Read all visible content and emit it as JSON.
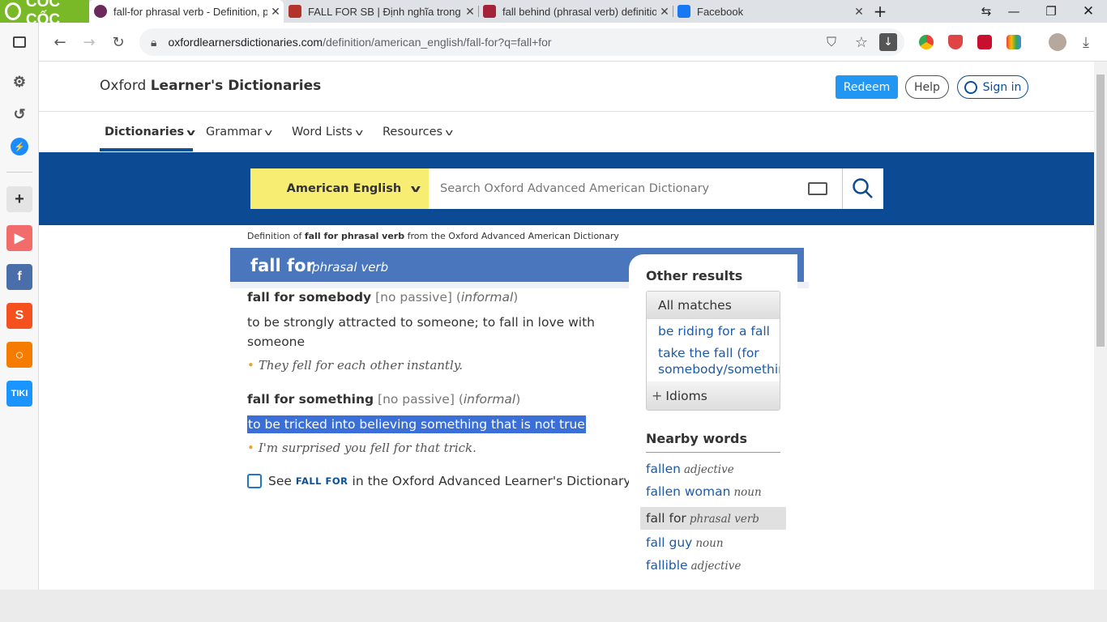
{
  "browser": {
    "brand": "CỐC CỐC",
    "tabs": [
      {
        "title": "fall-for phrasal verb - Definition, p",
        "active": true,
        "favicon_color": "#6b2a5c"
      },
      {
        "title": "FALL FOR SB | Định nghĩa trong Từ",
        "active": false,
        "favicon_color": "#b3342b"
      },
      {
        "title": "fall behind (phrasal verb) definition",
        "active": false,
        "favicon_color": "#a3233a"
      },
      {
        "title": "Facebook",
        "active": false,
        "favicon_color": "#1877f2"
      }
    ],
    "url_host": "oxfordlearnersdictionaries.com",
    "url_path": "/definition/american_english/fall-for?q=fall+for"
  },
  "site": {
    "title_plain": "Oxford",
    "title_bold": "Learner's Dictionaries",
    "redeem": "Redeem",
    "help": "Help",
    "signin": "Sign in",
    "nav": [
      "Dictionaries",
      "Grammar",
      "Word Lists",
      "Resources"
    ],
    "dictionary_selector": "American English",
    "search_placeholder": "Search Oxford Advanced American Dictionary"
  },
  "entry": {
    "def_prefix": "Definition of",
    "def_bold": "fall for phrasal verb",
    "def_suffix": "from the Oxford Advanced American Dictionary",
    "headword": "fall for",
    "pos": "phrasal verb",
    "senses": [
      {
        "phrase": "fall for somebody",
        "grammar": "[no passive]",
        "label": "informal",
        "definition": "to be strongly attracted to someone; to fall in love with someone",
        "example": "They fell for each other instantly."
      },
      {
        "phrase": "fall for something",
        "grammar": "[no passive]",
        "label": "informal",
        "definition": "to be tricked into believing something that is not true",
        "example": "I'm surprised you fell for that trick."
      }
    ],
    "see_prefix": "See",
    "see_link": "FALL FOR",
    "see_suffix": "in the Oxford Advanced Learner's Dictionary"
  },
  "sidebar": {
    "other_results": "Other results",
    "all_matches": "All matches",
    "matches": [
      "be riding for a fall",
      "take the fall (for",
      "somebody/somethin"
    ],
    "idioms": "Idioms",
    "nearby_title": "Nearby words",
    "nearby": [
      {
        "word": "fallen",
        "pos": "adjective"
      },
      {
        "word": "fallen woman",
        "pos": "noun"
      },
      {
        "word": "fall for",
        "pos": "phrasal verb",
        "current": true
      },
      {
        "word": "fall guy",
        "pos": "noun"
      },
      {
        "word": "fallible",
        "pos": "adjective"
      }
    ]
  },
  "colors": {
    "brand_green": "#79b927",
    "search_band": "#0c4a93",
    "head_band": "#4a76bd",
    "dict_selector": "#f8ed73",
    "redeem": "#2196f3",
    "selection": "#3a6fd8"
  },
  "icons": [
    "back-icon",
    "forward-icon",
    "reload-icon",
    "lock-icon",
    "shield-icon",
    "star-icon",
    "download-icon",
    "search-icon",
    "keyboard-icon",
    "external-link-icon",
    "user-icon"
  ]
}
